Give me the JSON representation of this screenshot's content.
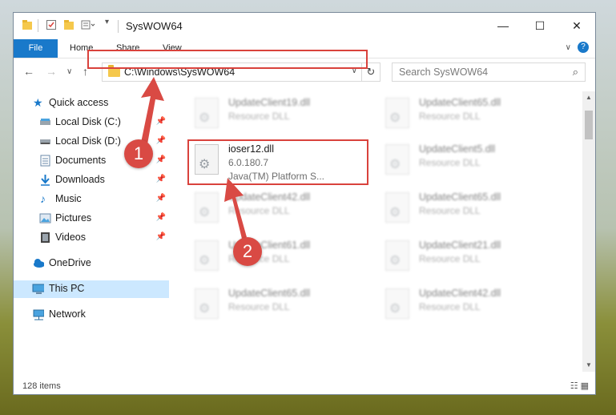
{
  "window": {
    "title": "SysWOW64",
    "controls": {
      "minimize": "—",
      "maximize": "☐",
      "close": "✕"
    }
  },
  "ribbon": {
    "tabs": [
      "File",
      "Home",
      "Share",
      "View"
    ],
    "help": "?"
  },
  "nav": {
    "address": "C:\\Windows\\SysWOW64",
    "search_placeholder": "Search SysWOW64"
  },
  "sidebar": {
    "items": [
      {
        "label": "Quick access",
        "icon": "star-icon"
      },
      {
        "label": "Local Disk (C:)",
        "icon": "drive-icon",
        "pinned": true
      },
      {
        "label": "Local Disk (D:)",
        "icon": "drive-icon",
        "pinned": true
      },
      {
        "label": "Documents",
        "icon": "documents-icon",
        "pinned": true
      },
      {
        "label": "Downloads",
        "icon": "downloads-icon",
        "pinned": true
      },
      {
        "label": "Music",
        "icon": "music-icon",
        "pinned": true
      },
      {
        "label": "Pictures",
        "icon": "pictures-icon",
        "pinned": true
      },
      {
        "label": "Videos",
        "icon": "videos-icon",
        "pinned": true
      },
      {
        "label": "OneDrive",
        "icon": "cloud-icon"
      },
      {
        "label": "This PC",
        "icon": "computer-icon",
        "selected": true
      },
      {
        "label": "Network",
        "icon": "network-icon"
      }
    ]
  },
  "files": {
    "left": [
      {
        "name": "UpdateClient19.dll",
        "desc": "Resource DLL"
      },
      {
        "name": "ioser12.dll",
        "desc": "6.0.180.7",
        "desc2": "Java(TM) Platform S..."
      },
      {
        "name": "UpdateClient42.dll",
        "desc": "Resource DLL"
      },
      {
        "name": "UpdateClient61.dll",
        "desc": "Resource DLL"
      },
      {
        "name": "UpdateClient65.dll",
        "desc": "Resource DLL"
      }
    ],
    "right": [
      {
        "name": "UpdateClient65.dll",
        "desc": "Resource DLL"
      },
      {
        "name": "UpdateClient5.dll",
        "desc": "Resource DLL"
      },
      {
        "name": "UpdateClient65.dll",
        "desc": "Resource DLL"
      },
      {
        "name": "UpdateClient21.dll",
        "desc": "Resource DLL"
      },
      {
        "name": "UpdateClient42.dll",
        "desc": "Resource DLL"
      }
    ]
  },
  "status": {
    "count": "128 items"
  },
  "callouts": [
    "1",
    "2"
  ],
  "colors": {
    "accent": "#1979ca",
    "highlight": "#d9423c",
    "callout": "#d94a44",
    "selected": "#cce8ff"
  }
}
